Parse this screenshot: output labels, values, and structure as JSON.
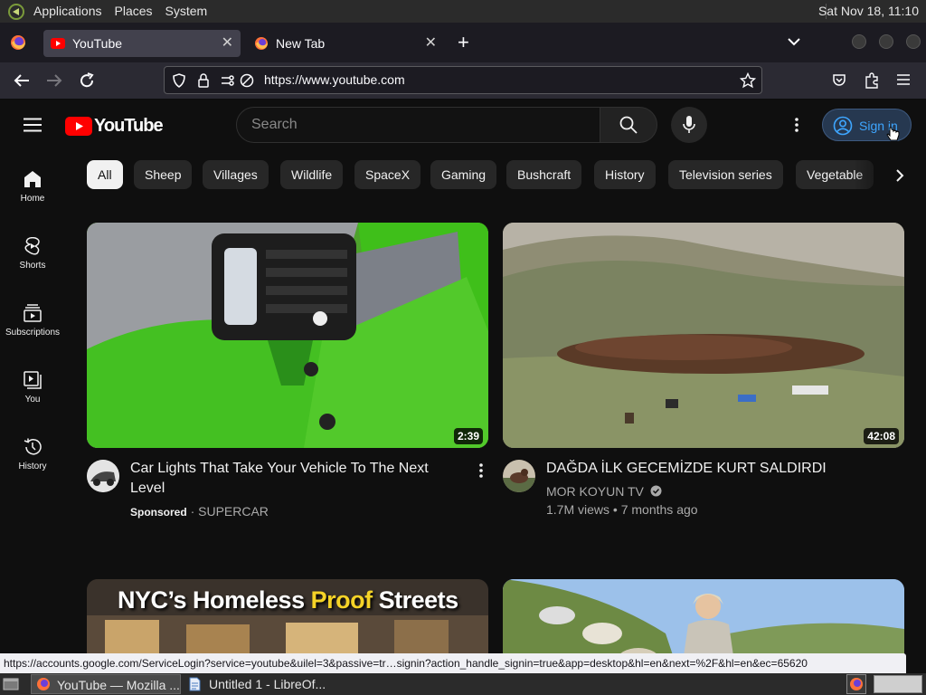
{
  "desktop": {
    "menus": [
      "Applications",
      "Places",
      "System"
    ],
    "clock": "Sat Nov 18, 11:10"
  },
  "browser": {
    "tabs": [
      {
        "title": "YouTube",
        "active": true
      },
      {
        "title": "New Tab",
        "active": false
      }
    ],
    "url": "https://www.youtube.com",
    "status_url": "https://accounts.google.com/ServiceLogin?service=youtube&uilel=3&passive=tr…signin?action_handle_signin=true&app=desktop&hl=en&next=%2F&hl=en&ec=65620"
  },
  "youtube": {
    "logo_text": "YouTube",
    "search_placeholder": "Search",
    "signin_label": "Sign in",
    "sidebar": [
      {
        "label": "Home",
        "icon": "home-icon"
      },
      {
        "label": "Shorts",
        "icon": "shorts-icon"
      },
      {
        "label": "Subscriptions",
        "icon": "subscriptions-icon"
      },
      {
        "label": "You",
        "icon": "you-icon"
      },
      {
        "label": "History",
        "icon": "history-icon"
      }
    ],
    "chips": [
      "All",
      "Sheep",
      "Villages",
      "Wildlife",
      "SpaceX",
      "Gaming",
      "Bushcraft",
      "History",
      "Television series",
      "Vegetable"
    ],
    "videos": [
      {
        "title_line1": "Car Lights That Take Your Vehicle To The Next",
        "title_line2": "Level",
        "sponsored": "Sponsored",
        "channel": "SUPERCAR",
        "duration": "2:39"
      },
      {
        "title": "DAĞDA İLK GECEMİZDE KURT SALDIRDI",
        "channel": "MOR KOYUN TV",
        "views": "1.7M views",
        "age": "7 months ago",
        "duration": "42:08"
      },
      {
        "thumb_text_1": "NYC’s Homeless",
        "thumb_text_2": "Proof",
        "thumb_text_3": "Streets"
      },
      {}
    ]
  },
  "taskbar": {
    "tasks": [
      "YouTube — Mozilla ...",
      "Untitled 1 - LibreOf..."
    ]
  },
  "colors": {
    "yt_red": "#ff0000",
    "link_blue": "#3ea6ff",
    "proof_yellow": "#f5d327"
  }
}
